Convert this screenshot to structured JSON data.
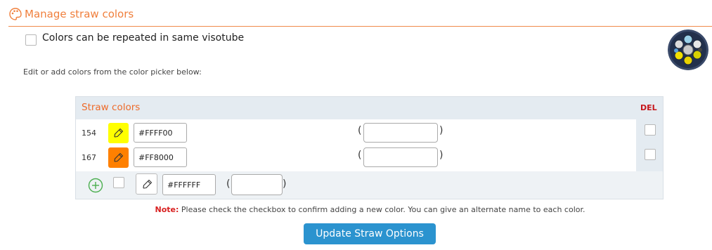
{
  "header": {
    "title": "Manage straw colors",
    "icon": "palette-icon",
    "accent": "#f07f3c"
  },
  "options": {
    "repeat_label": "Colors can be repeated in same visotube",
    "repeat_checked": false
  },
  "hint": "Edit or add colors from the color picker below:",
  "table": {
    "column_title": "Straw colors",
    "del_label": "DEL",
    "rows": [
      {
        "id": "154",
        "color": "#FFFF00",
        "hex": "#FFFF00",
        "alt_name": "",
        "del": false
      },
      {
        "id": "167",
        "color": "#FF8000",
        "hex": "#FF8000",
        "alt_name": "",
        "del": false
      }
    ],
    "new_row": {
      "hex": "#FFFFFF",
      "alt_name": "",
      "confirm": false
    }
  },
  "note": {
    "label": "Note:",
    "text": " Please check the checkbox to confirm adding a new color. You can give an alternate name to each color."
  },
  "update_button": "Update Straw Options",
  "colors": {
    "header_bg": "#e4ebf1",
    "button": "#2b93cf",
    "del": "#c6151a",
    "add": "#4caf50"
  }
}
